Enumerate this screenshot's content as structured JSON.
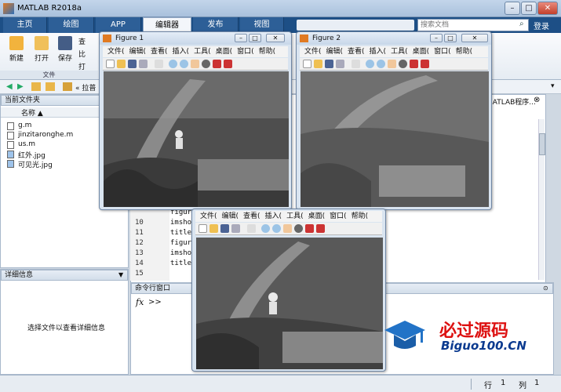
{
  "app": {
    "title": "MATLAB R2018a"
  },
  "tabs": [
    "主页",
    "绘图",
    "APP",
    "编辑器",
    "发布",
    "视图"
  ],
  "search": {
    "placeholder": "搜索文档"
  },
  "login": "登录",
  "ribbon": {
    "new": "新建",
    "open": "打开",
    "save": "保存",
    "section_file": "文件",
    "find": "查",
    "compare": "比",
    "print": "打"
  },
  "address": {
    "label": "« 拉普"
  },
  "current_folder": {
    "title": "当前文件夹",
    "column": "名称 ▲",
    "files": [
      "g.m",
      "jinzitaronghe.m",
      "us.m",
      "红外.jpg",
      "可见光.jpg"
    ]
  },
  "details": {
    "title": "详细信息",
    "message": "选择文件以查看详细信息"
  },
  "editor": {
    "path_fragment": "MATLAB程序..."
  },
  "code": {
    "lines": [
      {
        "n": "10",
        "code": "imshow"
      },
      {
        "n": "11",
        "code": "title"
      },
      {
        "n": "12",
        "code": "figure"
      },
      {
        "n": "13",
        "code": "imshow"
      },
      {
        "n": "14",
        "code": "title"
      },
      {
        "n": "15",
        "code": ""
      }
    ],
    "figure_fragment": "figur"
  },
  "command_window": {
    "title": "命令行窗口",
    "prompt": ">>"
  },
  "figure1": {
    "title": "Figure 1"
  },
  "figure2": {
    "title": "Figure 2"
  },
  "figure_menu": [
    "文件(",
    "编辑(",
    "查看(",
    "插入(",
    "工具(",
    "桌面(",
    "窗口(",
    "帮助("
  ],
  "figure3_menu": [
    "文件(",
    "编辑(",
    "查看(",
    "插入(",
    "工具(",
    "桌面(",
    "窗口(",
    "帮助("
  ],
  "status": {
    "row_label": "行",
    "row": "1",
    "col_label": "列",
    "col": "1"
  },
  "watermark": {
    "line1": "必过源码",
    "line2": "Biguo100.CN"
  }
}
